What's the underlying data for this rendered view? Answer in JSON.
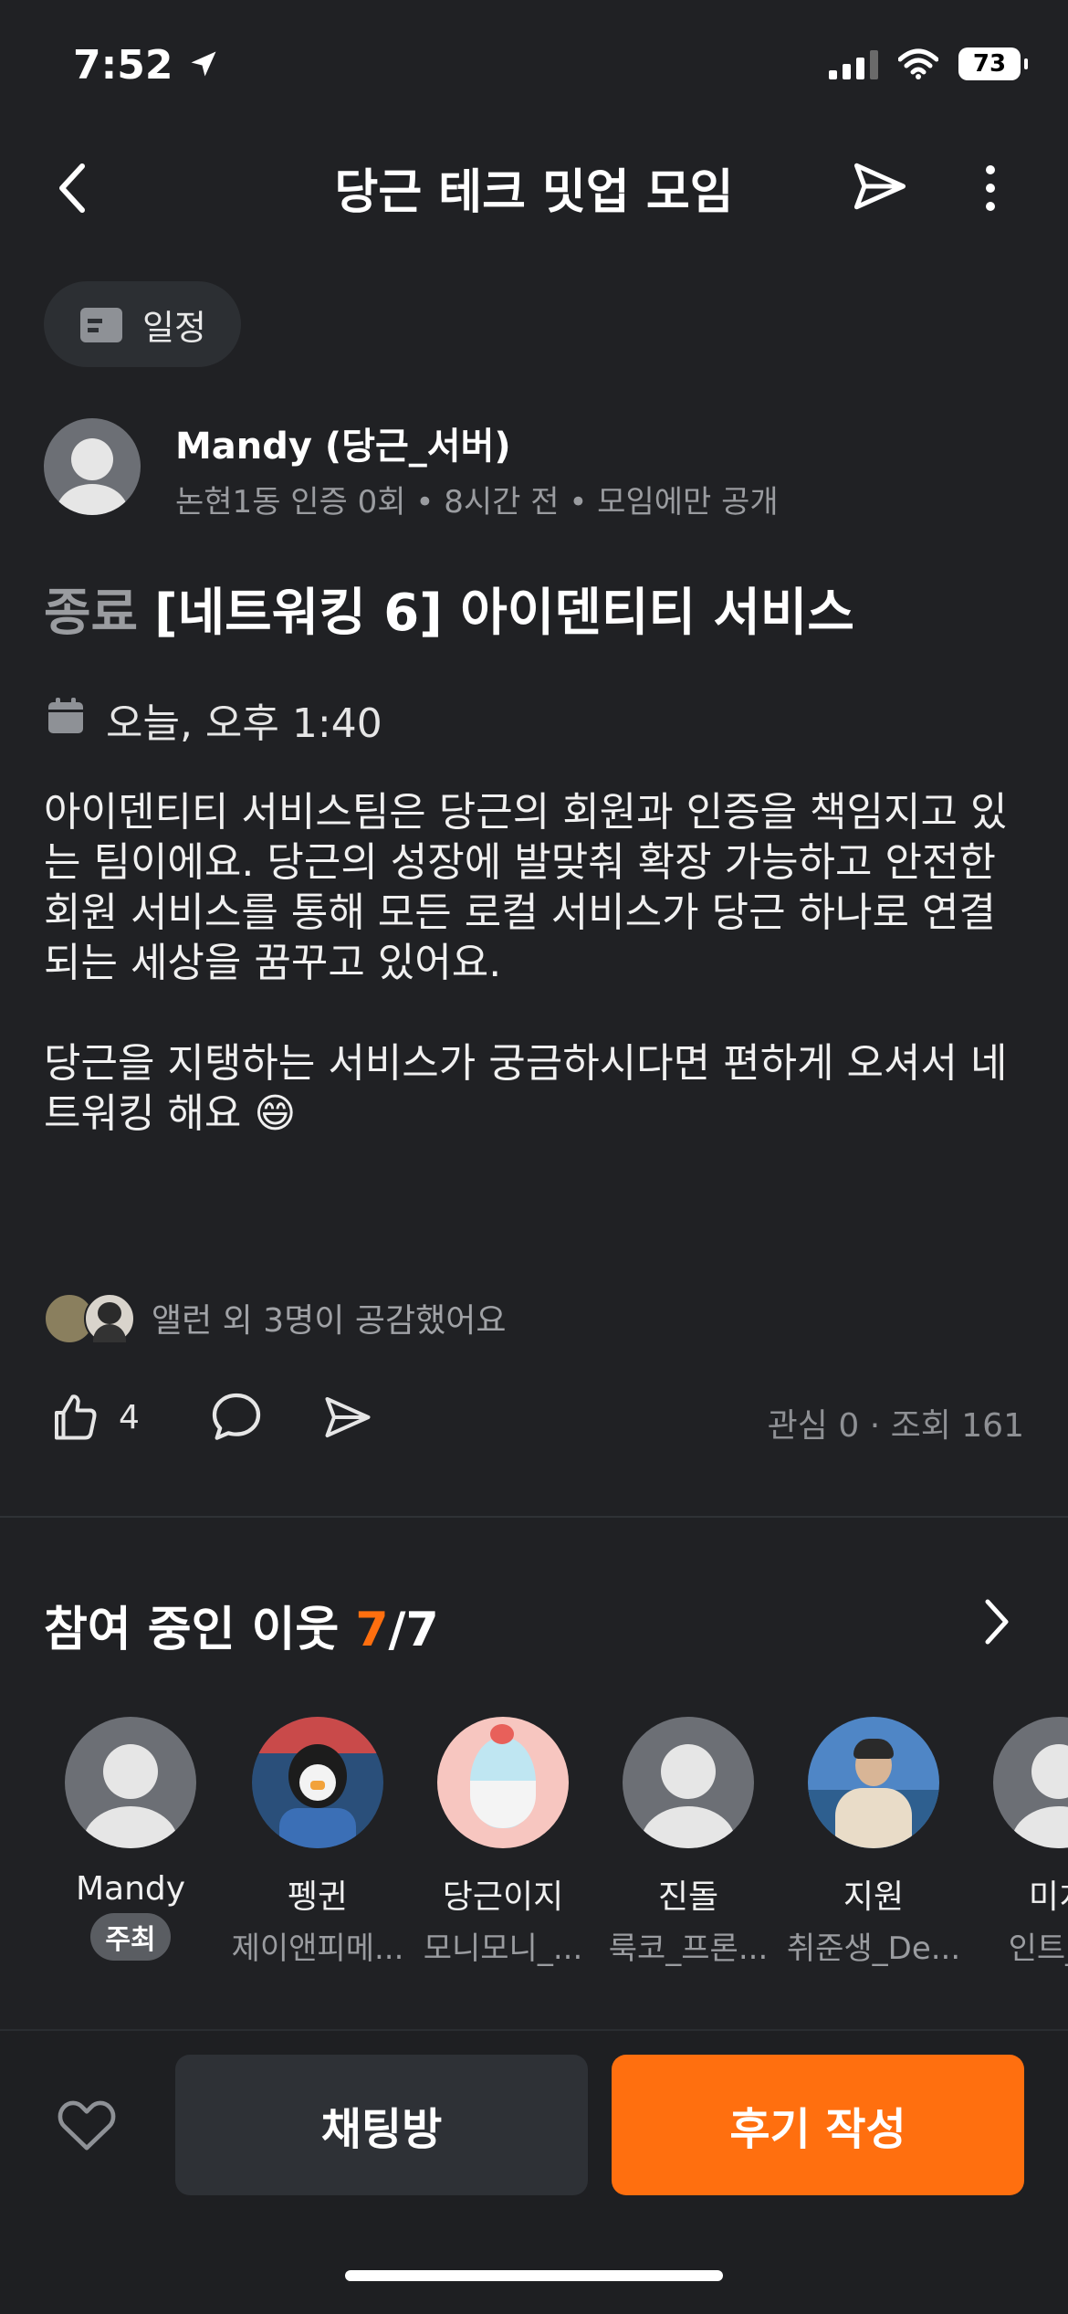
{
  "status_bar": {
    "time": "7:52",
    "battery": "73"
  },
  "nav": {
    "title": "당근 테크 밋업 모임"
  },
  "chip": {
    "label": "일정"
  },
  "author": {
    "name": "Mandy (당근_서버)",
    "meta": "논현1동 인증 0회 • 8시간 전 • 모임에만 공개"
  },
  "post": {
    "status": "종료",
    "title": "[네트워킹 6] 아이덴티티 서비스",
    "date": "오늘, 오후 1:40",
    "body_line1": "아이덴티티 서비스팀은 당근의 회원과 인증을 책임지고 있",
    "body_line2": "는 팀이에요. 당근의 성장에 발맞춰 확장 가능하고 안전한",
    "body_line3": "회원 서비스를 통해 모든 로컬 서비스가 당근 하나로 연결",
    "body_line4": "되는 세상을 꿈꾸고 있어요.",
    "body_line5": "당근을 지탱하는 서비스가 궁금하시다면 편하게 오셔서 네",
    "body_line6": "트워킹 해요 😄",
    "likers_text": "앨런 외 3명이 공감했어요",
    "like_count": "4",
    "stats": "관심 0 · 조회 161"
  },
  "participants": {
    "title": "참여 중인 이웃",
    "current": "7",
    "total": "/7",
    "host_badge": "주최",
    "list": [
      {
        "name": "Mandy",
        "sub": ""
      },
      {
        "name": "펭귄",
        "sub": "제이앤피메..."
      },
      {
        "name": "당근이지",
        "sub": "모니모니_..."
      },
      {
        "name": "진돌",
        "sub": "룩코_프론..."
      },
      {
        "name": "지원",
        "sub": "취준생_De..."
      },
      {
        "name": "미치",
        "sub": "인트_프"
      }
    ]
  },
  "bottom": {
    "chat_label": "채팅방",
    "review_label": "후기 작성"
  },
  "colors": {
    "accent": "#ff6f0f",
    "background": "#202124"
  }
}
